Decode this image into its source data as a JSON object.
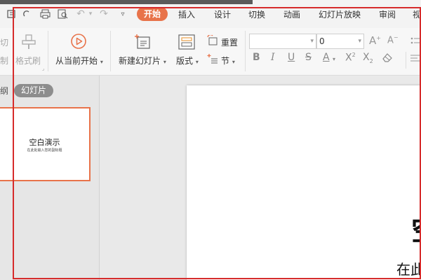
{
  "menu": {
    "tabs": [
      "开始",
      "插入",
      "设计",
      "切换",
      "动画",
      "幻灯片放映",
      "审阅",
      "视"
    ]
  },
  "ribbon": {
    "cut_label": "切",
    "cut_sub": "制",
    "format_painter": "格式刷",
    "from_current": "从当前开始",
    "new_slide": "新建幻灯片",
    "layout": "版式",
    "reset": "重置",
    "section": "节",
    "font_size_value": "0"
  },
  "panel": {
    "tab_outline": "纲",
    "tab_slides": "幻灯片",
    "thumb_title": "空白演示",
    "thumb_subtitle": "在此处输入您的副标题"
  },
  "slide": {
    "title": "空",
    "subtitle": "在此"
  },
  "colors": {
    "accent": "#e8734a",
    "highlight_box": "#d62b2b"
  }
}
